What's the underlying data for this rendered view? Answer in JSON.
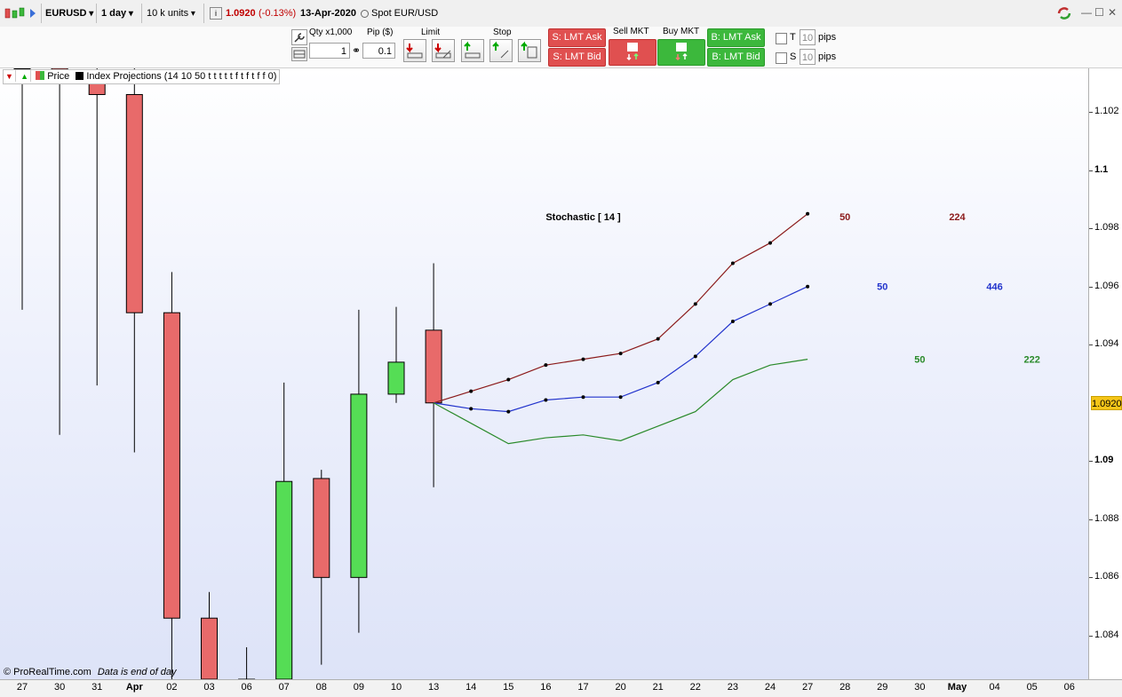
{
  "toolbar": {
    "symbol": "EURUSD",
    "timeframe": "1 day",
    "units": "10 k units",
    "info_icon": "i",
    "price": "1.0920",
    "change": "(-0.13%)",
    "date": "13-Apr-2020",
    "spot_label": "Spot EUR/USD"
  },
  "order": {
    "qty_label": "Qty x1,000",
    "pip_label": "Pip ($)",
    "qty_value": "1",
    "pip_value": "0.1",
    "limit_label": "Limit",
    "stop_label": "Stop",
    "sell_lmt_ask": "S: LMT Ask",
    "sell_lmt_bid": "S: LMT Bid",
    "sell_mkt": "Sell MKT",
    "buy_mkt": "Buy MKT",
    "buy_lmt_ask": "B: LMT Ask",
    "buy_lmt_bid": "B: LMT Bid",
    "t_label": "T",
    "s_label": "S",
    "t_value": "10",
    "s_value": "10",
    "pips": "pips"
  },
  "legend": {
    "price": "Price",
    "indicator": "Index Projections (14 10 50 t t t t t f t f t f f 0)"
  },
  "footer": {
    "brand": "© ProRealTime.com",
    "note": "Data is end of day"
  },
  "colors": {
    "bear": "#e86a6a",
    "bull": "#55dd55",
    "line_red": "#8b1a1a",
    "line_blue": "#2233cc",
    "line_green": "#2a8a2a",
    "price_tag": "#f5c518"
  },
  "chart_data": {
    "type": "candlestick",
    "ylim": [
      1.0825,
      1.1035
    ],
    "y_ticks": [
      1.102,
      1.1,
      1.098,
      1.096,
      1.094,
      1.092,
      1.09,
      1.088,
      1.086,
      1.084
    ],
    "y_tick_labels": [
      "1.102",
      "1.1",
      "1.098",
      "1.096",
      "1.094",
      "1.0920",
      "1.09",
      "1.088",
      "1.086",
      "1.084"
    ],
    "x_labels": [
      "27",
      "30",
      "31",
      "Apr",
      "02",
      "03",
      "06",
      "07",
      "08",
      "09",
      "10",
      "13",
      "14",
      "15",
      "16",
      "17",
      "20",
      "21",
      "22",
      "23",
      "24",
      "27",
      "28",
      "29",
      "30",
      "May",
      "04",
      "05",
      "06"
    ],
    "candles": [
      {
        "date": "27",
        "open": 1.1035,
        "high": 1.1035,
        "low": 1.0952,
        "close": 1.1035
      },
      {
        "date": "30",
        "open": 1.1035,
        "high": 1.1035,
        "low": 1.0909,
        "close": 1.103
      },
      {
        "date": "31",
        "open": 1.103,
        "high": 1.1035,
        "low": 1.0926,
        "close": 1.1026
      },
      {
        "date": "Apr",
        "open": 1.1026,
        "high": 1.1035,
        "low": 1.0903,
        "close": 1.0951
      },
      {
        "date": "02",
        "open": 1.0951,
        "high": 1.0965,
        "low": 1.0825,
        "close": 1.0846
      },
      {
        "date": "03",
        "open": 1.0846,
        "high": 1.0855,
        "low": 1.0825,
        "close": 1.0825
      },
      {
        "date": "06",
        "open": 1.0825,
        "high": 1.0836,
        "low": 1.0825,
        "close": 1.0825
      },
      {
        "date": "07",
        "open": 1.0825,
        "high": 1.0927,
        "low": 1.0825,
        "close": 1.0893
      },
      {
        "date": "08",
        "open": 1.0894,
        "high": 1.0897,
        "low": 1.083,
        "close": 1.086
      },
      {
        "date": "09",
        "open": 1.086,
        "high": 1.0952,
        "low": 1.0841,
        "close": 1.0923
      },
      {
        "date": "10",
        "open": 1.0923,
        "high": 1.0953,
        "low": 1.092,
        "close": 1.0934
      },
      {
        "date": "13",
        "open": 1.0945,
        "high": 1.0968,
        "low": 1.0891,
        "close": 1.092
      }
    ],
    "projection_dates": [
      "13",
      "14",
      "15",
      "16",
      "17",
      "20",
      "21",
      "22",
      "23",
      "24",
      "27"
    ],
    "series": [
      {
        "name": "",
        "color": "#8b1a1a",
        "markers": true,
        "values": [
          1.092,
          1.0924,
          1.0928,
          1.0933,
          1.0935,
          1.0937,
          1.0942,
          1.0954,
          1.0968,
          1.0975,
          1.0985
        ]
      },
      {
        "name": "",
        "color": "#2233cc",
        "markers": true,
        "values": [
          1.092,
          1.0918,
          1.0917,
          1.0921,
          1.0922,
          1.0922,
          1.0927,
          1.0936,
          1.0948,
          1.0954,
          1.096
        ]
      },
      {
        "name": "",
        "color": "#2a8a2a",
        "markers": false,
        "values": [
          1.092,
          1.0913,
          1.0906,
          1.0908,
          1.0909,
          1.0907,
          1.0912,
          1.0917,
          1.0928,
          1.0933,
          1.0935
        ]
      }
    ],
    "annotations": [
      {
        "text": "Stochastic [ 14 ]",
        "date": "17",
        "y": 1.0984,
        "color": "#000000"
      },
      {
        "text": "50",
        "date": "28",
        "y": 1.0984,
        "color": "#8b1a1a"
      },
      {
        "text": "224",
        "date": "May",
        "y": 1.0984,
        "color": "#8b1a1a"
      },
      {
        "text": "50",
        "date": "29",
        "y": 1.096,
        "color": "#2233cc"
      },
      {
        "text": "446",
        "date": "04",
        "y": 1.096,
        "color": "#2233cc"
      },
      {
        "text": "50",
        "date": "30",
        "y": 1.0935,
        "color": "#2a8a2a"
      },
      {
        "text": "222",
        "date": "05",
        "y": 1.0935,
        "color": "#2a8a2a"
      }
    ]
  }
}
